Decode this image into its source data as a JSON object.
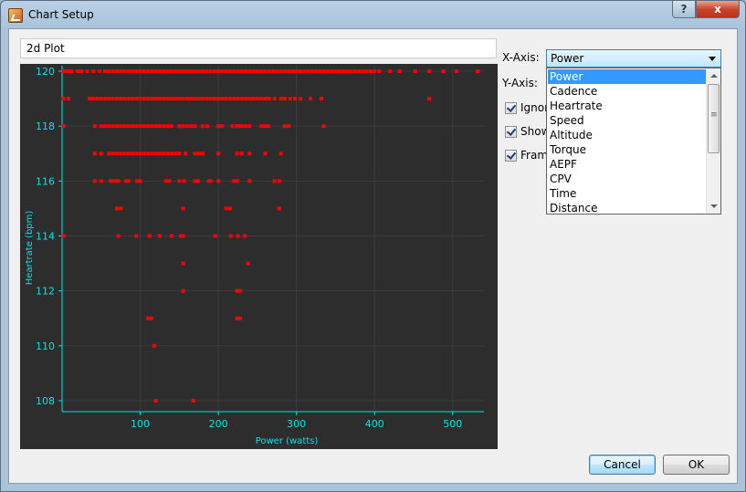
{
  "window": {
    "title": "Chart Setup",
    "help_label": "?",
    "close_label": "x"
  },
  "chart_title_input": {
    "value": "2d Plot"
  },
  "x_axis": {
    "label": "X-Axis:",
    "selected": "Power",
    "options": [
      "Power",
      "Cadence",
      "Heartrate",
      "Speed",
      "Altitude",
      "Torque",
      "AEPF",
      "CPV",
      "Time",
      "Distance"
    ]
  },
  "y_axis": {
    "label": "Y-Axis:"
  },
  "checkboxes": [
    {
      "label": "Ignor",
      "checked": true
    },
    {
      "label": "Show",
      "checked": true
    },
    {
      "label": "Fram",
      "checked": true
    }
  ],
  "buttons": {
    "cancel": "Cancel",
    "ok": "OK"
  },
  "chart_data": {
    "type": "scatter",
    "xlabel": "Power (watts)",
    "ylabel": "Heartrate (bpm)",
    "xlim": [
      0,
      540
    ],
    "ylim": [
      107.6,
      120.2
    ],
    "x_ticks": [
      100,
      200,
      300,
      400,
      500
    ],
    "y_ticks": [
      108,
      110,
      112,
      114,
      116,
      118,
      120
    ],
    "colors": {
      "points": "#ff0000",
      "axes": "#00e5e5",
      "background": "#2d2d2d",
      "grid": "#3c3c3c"
    },
    "rows": [
      {
        "y": 120,
        "x": [
          2,
          5,
          8,
          12,
          20,
          25,
          32,
          40,
          48,
          55,
          60,
          65,
          70,
          75,
          80,
          85,
          90,
          95,
          100,
          105,
          110,
          115,
          120,
          125,
          130,
          135,
          140,
          145,
          150,
          155,
          160,
          165,
          170,
          175,
          180,
          185,
          190,
          195,
          200,
          205,
          210,
          215,
          220,
          225,
          230,
          235,
          240,
          245,
          250,
          255,
          260,
          265,
          270,
          275,
          280,
          285,
          290,
          295,
          300,
          305,
          310,
          315,
          320,
          325,
          330,
          335,
          340,
          345,
          350,
          355,
          360,
          365,
          370,
          375,
          380,
          385,
          390,
          395,
          400,
          406,
          420,
          432,
          452,
          470,
          488,
          505,
          532
        ]
      },
      {
        "y": 119,
        "x": [
          2,
          8,
          35,
          40,
          45,
          50,
          55,
          60,
          65,
          70,
          75,
          80,
          85,
          90,
          95,
          100,
          105,
          110,
          115,
          120,
          125,
          130,
          135,
          140,
          145,
          150,
          155,
          160,
          165,
          170,
          175,
          180,
          185,
          190,
          195,
          200,
          205,
          210,
          215,
          220,
          225,
          230,
          235,
          240,
          245,
          250,
          255,
          260,
          265,
          272,
          280,
          285,
          292,
          298,
          305,
          318,
          332,
          470
        ]
      },
      {
        "y": 118,
        "x": [
          2,
          42,
          50,
          55,
          60,
          65,
          70,
          75,
          80,
          85,
          90,
          95,
          100,
          105,
          110,
          115,
          120,
          125,
          130,
          135,
          140,
          150,
          155,
          160,
          165,
          170,
          180,
          186,
          200,
          205,
          218,
          224,
          226,
          230,
          235,
          240,
          255,
          260,
          264,
          285,
          290,
          335
        ]
      },
      {
        "y": 117,
        "x": [
          42,
          50,
          60,
          65,
          70,
          75,
          80,
          85,
          90,
          95,
          100,
          105,
          110,
          115,
          120,
          125,
          130,
          135,
          140,
          145,
          150,
          158,
          170,
          175,
          180,
          200,
          224,
          230,
          240,
          260,
          280
        ]
      },
      {
        "y": 116,
        "x": [
          42,
          50,
          62,
          65,
          70,
          72,
          82,
          85,
          96,
          100,
          133,
          137,
          150,
          156,
          170,
          172,
          174,
          188,
          190,
          200,
          220,
          224,
          240,
          272,
          278
        ]
      },
      {
        "y": 115,
        "x": [
          70,
          75,
          155,
          210,
          215,
          278
        ]
      },
      {
        "y": 114,
        "x": [
          2,
          72,
          95,
          112,
          125,
          140,
          152,
          155,
          196,
          216,
          225,
          234
        ]
      },
      {
        "y": 113,
        "x": [
          155,
          238
        ]
      },
      {
        "y": 112,
        "x": [
          155,
          224,
          228
        ]
      },
      {
        "y": 111,
        "x": [
          110,
          114,
          224,
          228
        ]
      },
      {
        "y": 110,
        "x": [
          118
        ]
      },
      {
        "y": 108,
        "x": [
          120,
          168
        ]
      }
    ]
  }
}
